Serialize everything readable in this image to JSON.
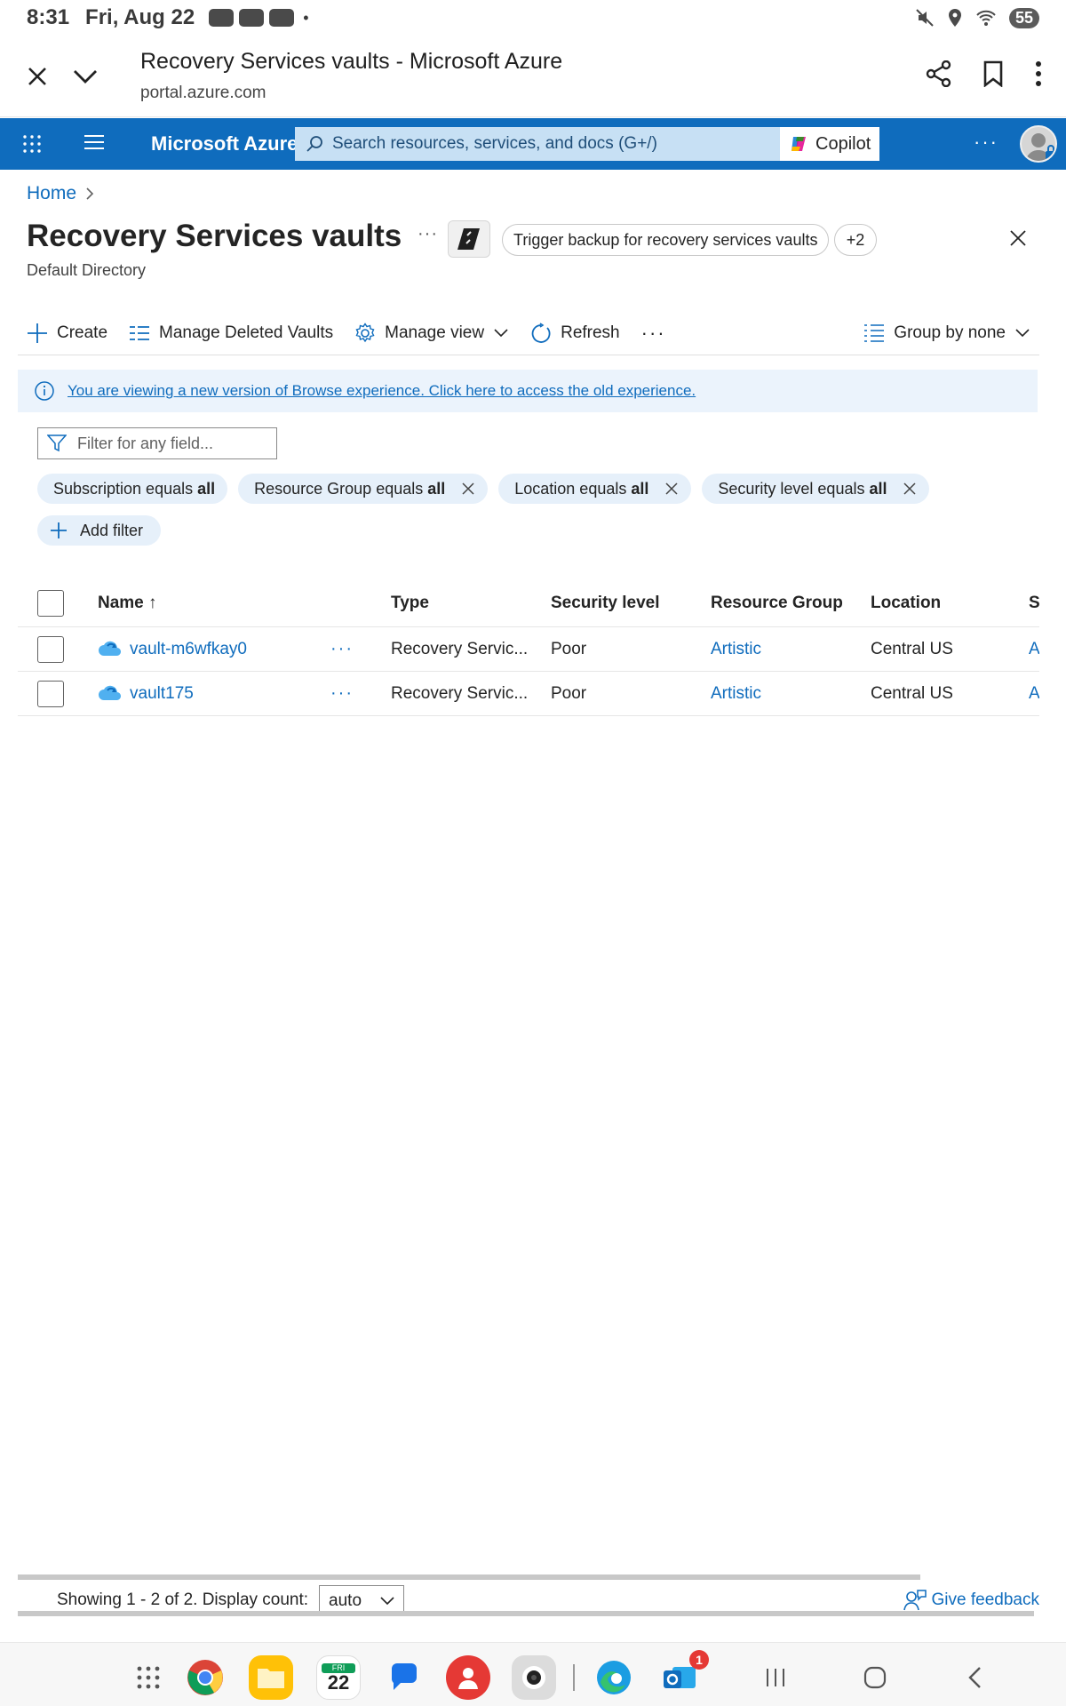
{
  "status_bar": {
    "time": "8:31",
    "date": "Fri, Aug 22",
    "battery": "55"
  },
  "browser": {
    "page_title": "Recovery Services vaults - Microsoft Azure",
    "url": "portal.azure.com"
  },
  "azure_bar": {
    "brand": "Microsoft Azure",
    "search_placeholder": "Search resources, services, and docs (G+/)",
    "copilot_label": "Copilot",
    "more": "···"
  },
  "breadcrumb": {
    "home": "Home"
  },
  "blade": {
    "title": "Recovery Services vaults",
    "subtitle": "Default Directory",
    "ellipsis": "···",
    "prompt_suggestion": "Trigger backup for recovery services vaults",
    "more_prompts": "+2"
  },
  "commands": {
    "create": "Create",
    "manage_deleted": "Manage Deleted Vaults",
    "manage_view": "Manage view",
    "refresh": "Refresh",
    "more": "···",
    "group_by": "Group by none"
  },
  "banner": {
    "text": "You are viewing a new version of Browse experience. Click here to access the old experience."
  },
  "filter": {
    "placeholder": "Filter for any field...",
    "pills": [
      {
        "label": "Subscription equals ",
        "value": "all"
      },
      {
        "label": "Resource Group equals ",
        "value": "all"
      },
      {
        "label": "Location equals ",
        "value": "all"
      },
      {
        "label": "Security level equals ",
        "value": "all"
      }
    ],
    "add_filter": "Add filter"
  },
  "table": {
    "columns": [
      "Name ↑",
      "Type",
      "Security level",
      "Resource Group",
      "Location",
      "S"
    ],
    "rows": [
      {
        "name": "vault-m6wfkay0",
        "dots": "···",
        "type": "Recovery Servic...",
        "security": "Poor",
        "resource_group": "Artistic",
        "location": "Central US",
        "s": "A"
      },
      {
        "name": "vault175",
        "dots": "···",
        "type": "Recovery Servic...",
        "security": "Poor",
        "resource_group": "Artistic",
        "location": "Central US",
        "s": "A"
      }
    ]
  },
  "footer": {
    "showing": "Showing 1 - 2 of 2. Display count:",
    "display_count": "auto",
    "feedback": "Give feedback"
  },
  "nav": {
    "calendar_day": "22",
    "calendar_weekday": "FRI",
    "outlook_badge": "1"
  },
  "colors": {
    "azure_blue": "#0f6cbd",
    "search_bg": "#c7e0f4",
    "pill_bg": "#e6f0fa",
    "banner_bg": "#ebf3fc"
  }
}
